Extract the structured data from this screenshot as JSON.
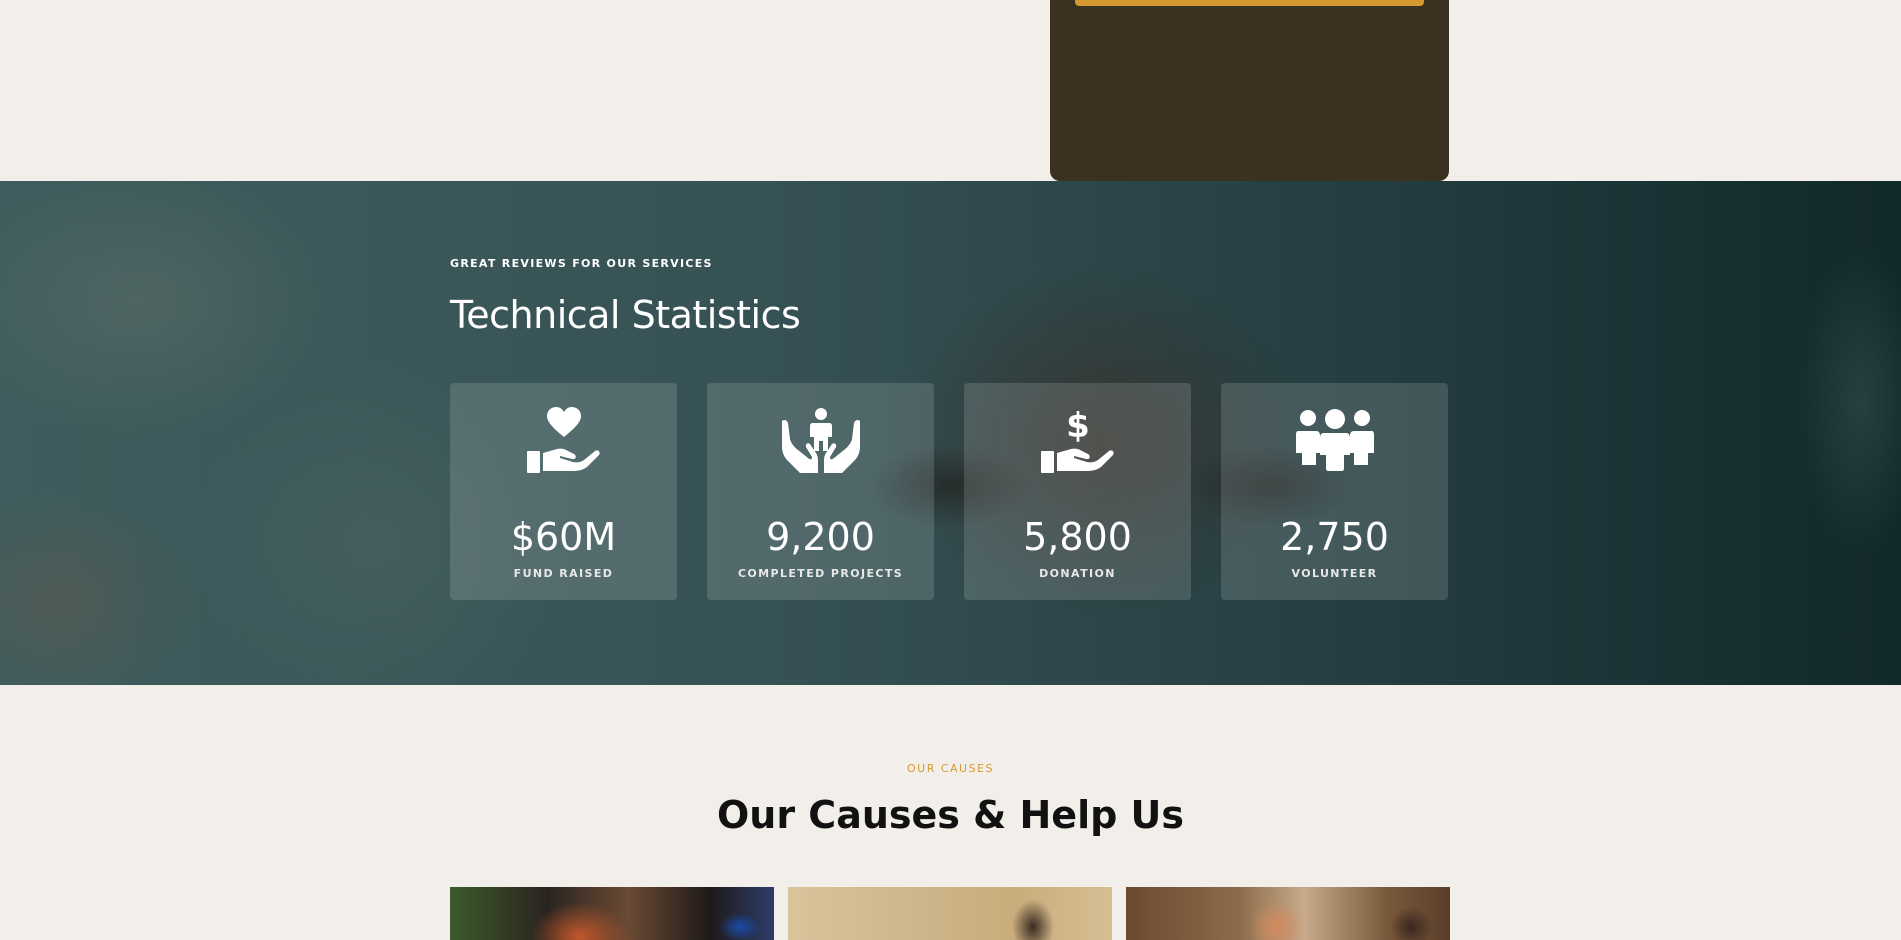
{
  "top_card": {
    "button_color": "#d6992f",
    "background_color": "#3a3120"
  },
  "stats": {
    "eyebrow": "GREAT REVIEWS FOR OUR SERVICES",
    "title": "Technical Statistics",
    "items": [
      {
        "icon": "heart-hand-icon",
        "value": "$60M",
        "label": "FUND RAISED"
      },
      {
        "icon": "hands-child-icon",
        "value": "9,200",
        "label": "COMPLETED PROJECTS"
      },
      {
        "icon": "dollar-hand-icon",
        "value": "5,800",
        "label": "DONATION"
      },
      {
        "icon": "people-group-icon",
        "value": "2,750",
        "label": "VOLUNTEER"
      }
    ]
  },
  "causes": {
    "eyebrow": "OUR CAUSES",
    "title": "Our Causes & Help Us",
    "accent_color": "#d6992f"
  }
}
